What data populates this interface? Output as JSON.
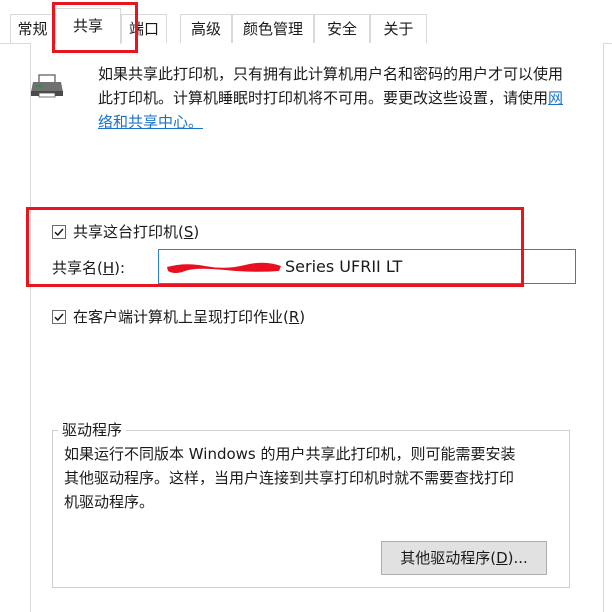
{
  "tabs": [
    {
      "label": "常规"
    },
    {
      "label": "共享"
    },
    {
      "label": "端口"
    },
    {
      "label": "高级"
    },
    {
      "label": "颜色管理"
    },
    {
      "label": "安全"
    },
    {
      "label": "关于"
    }
  ],
  "active_tab": "共享",
  "info": {
    "icon": "printer-icon",
    "line1": "如果共享此打印机，只有拥有此计算机用户名和密码的用户才可以使用",
    "line2_text": "此打印机。计算机睡眠时打印机将不可用。要更改这些设置，请使用",
    "link_part1": "网",
    "link_part2": "络和共享中心。"
  },
  "share_checkbox": {
    "label_prefix": "共享这台打印机(",
    "hotkey": "S",
    "label_suffix": ")",
    "checked": true
  },
  "share_name": {
    "label_prefix": "共享名(",
    "hotkey": "H",
    "label_suffix": "):",
    "value_visible": "Series UFRII LT",
    "redacted": true
  },
  "render_checkbox": {
    "label_prefix": "在客户端计算机上呈现打印作业(",
    "hotkey": "R",
    "label_suffix": ")",
    "checked": true
  },
  "drivers": {
    "title": "驱动程序",
    "line1": "如果运行不同版本 Windows 的用户共享此打印机，则可能需要安装",
    "line2": "其他驱动程序。这样，当用户连接到共享打印机时就不需要查找打印",
    "line3": "机驱动程序。",
    "button_prefix": "其他驱动程序(",
    "button_hotkey": "D",
    "button_suffix": ")..."
  },
  "colors": {
    "highlight": "#e8141e",
    "link": "#1a73c9",
    "input_border": "#2f7fd1"
  }
}
